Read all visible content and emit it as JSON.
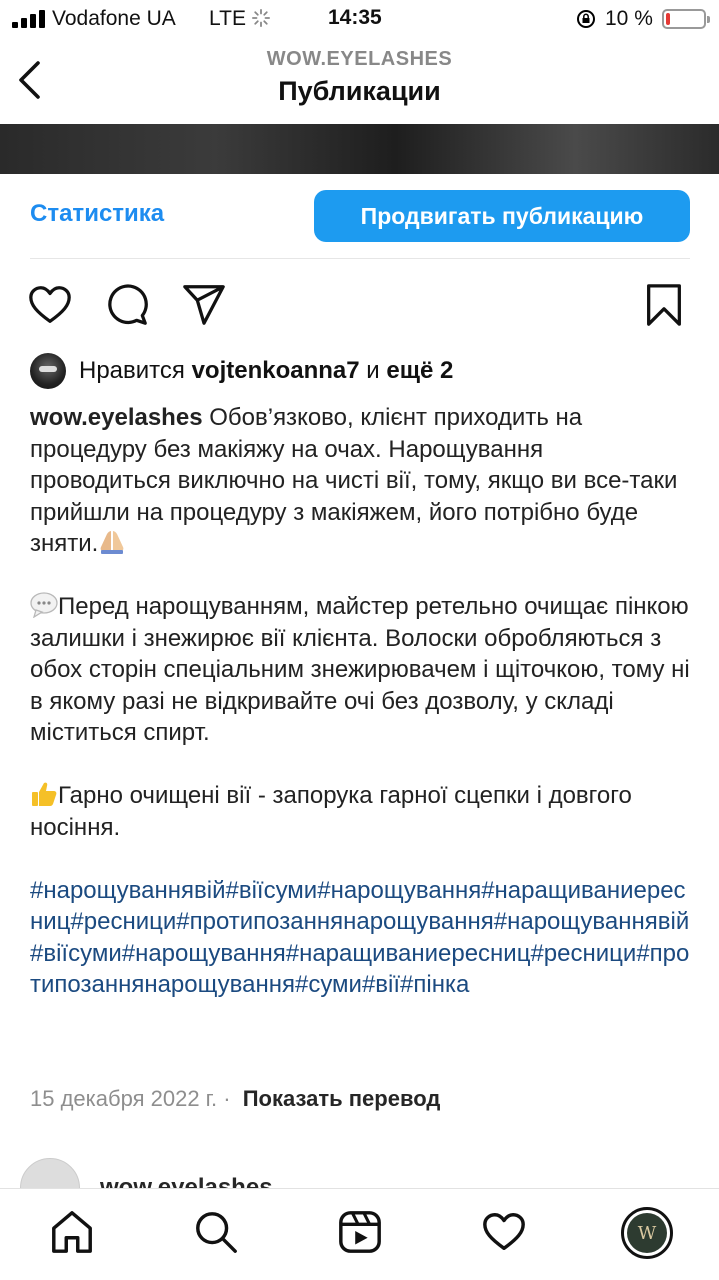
{
  "status_bar": {
    "carrier": "Vodafone UA",
    "network": "LTE",
    "time": "14:35",
    "battery_percent": "10 %",
    "battery_level": 0.1,
    "battery_color": "#e53935"
  },
  "header": {
    "account": "WOW.EYELASHES",
    "title": "Публикации",
    "back_icon": "chevron-left-icon"
  },
  "post_actions": {
    "statistics_label": "Статистика",
    "promote_label": "Продвигать публикацию",
    "promote_color": "#1d9bf0",
    "icons": [
      "heart-icon",
      "comment-icon",
      "share-icon",
      "bookmark-icon"
    ]
  },
  "likes": {
    "prefix": "Нравится",
    "user": "vojtenkoanna7",
    "joiner": "и",
    "more": "ещё 2"
  },
  "caption": {
    "username": "wow.eyelashes",
    "paragraph1": "Обов’язково, клієнт приходить на процедуру без макіяжу на очах. Нарощування проводиться виключно на чисті вії, тому, якщо ви все-таки прийшли на процедуру з макіяжем, його потрібно буде зняти.",
    "paragraph2": "Перед нарощуванням, майстер ретельно очищає пінкою залишки і знежирює вії клієнта. Волоски обробляються з обох сторін спеціальним знежирювачем і  щіточкою, тому ні в якому разі не відкривайте очі без дозволу, у складі міститься спирт.",
    "paragraph3": "Гарно очищені вії - запорука гарної сцепки і довгого носіння.",
    "hashtags": "#нарощуваннявій#віїсуми#нарощування#наращиваниересниц#ресници#протипозаннянарощування#нарощуваннявій#віїсуми#нарощування#наращиваниересниц#ресници#протипозаннянарощування#суми#вії#пінка",
    "emojis": [
      "folded-hands-emoji",
      "speech-bubble-emoji",
      "thumbs-up-emoji"
    ]
  },
  "meta": {
    "date": "15 декабря 2022 г.",
    "separator": "·",
    "translate": "Показать перевод"
  },
  "next_post": {
    "username": "wow.eyelashes"
  },
  "tab_bar": {
    "icons": [
      "home-icon",
      "search-icon",
      "reels-icon",
      "activity-heart-icon",
      "profile-avatar"
    ],
    "profile_initial": "W"
  }
}
